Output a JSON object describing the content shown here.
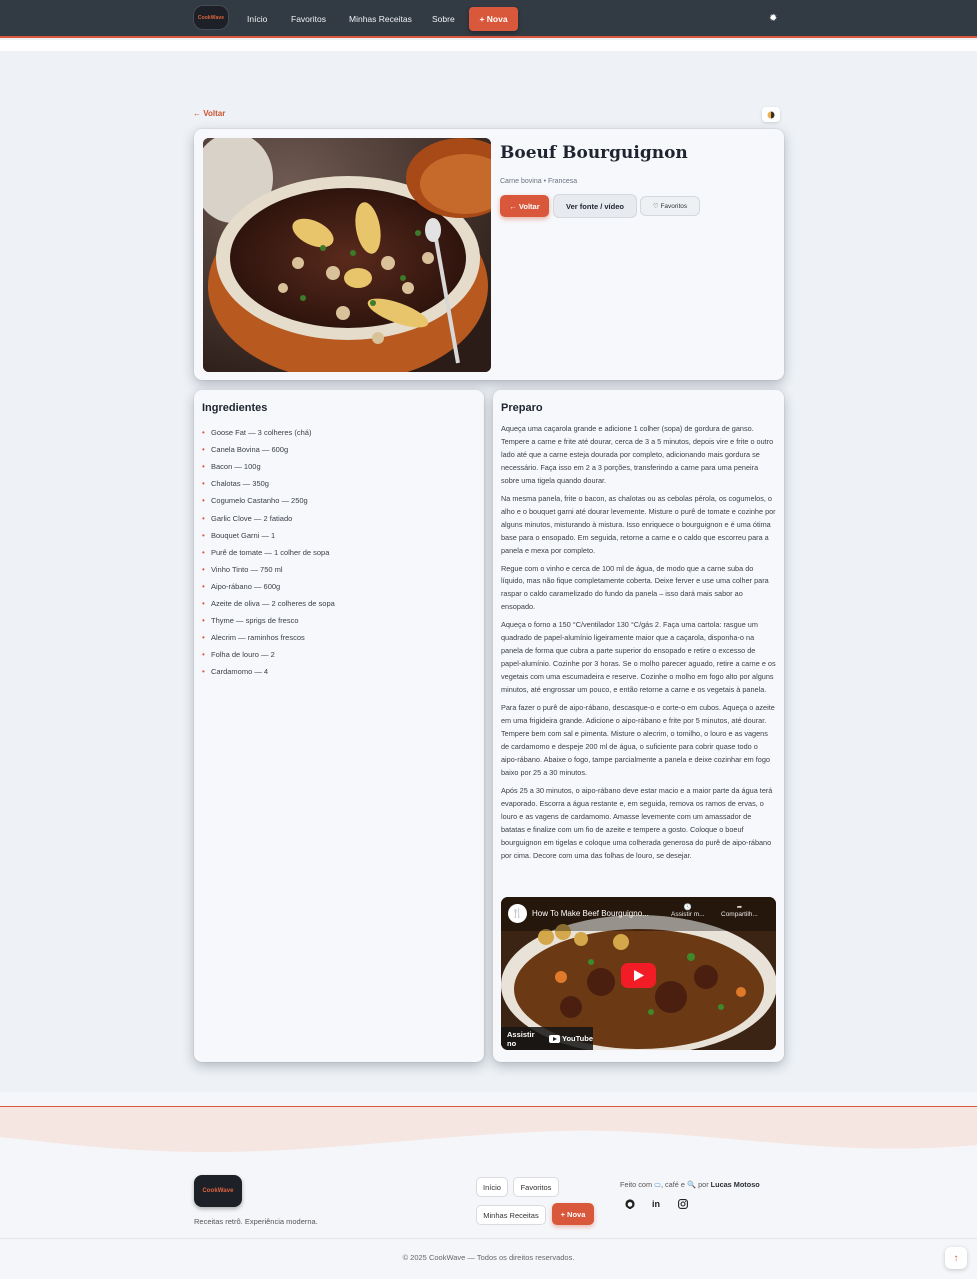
{
  "brand": {
    "name": "CookWave",
    "accent": "#d9573a",
    "dark": "#323a44"
  },
  "nav": {
    "items": [
      "Início",
      "Favoritos",
      "Minhas Receitas",
      "Sobre"
    ],
    "new_label": "+ Nova",
    "theme_icon": "sun-icon"
  },
  "page": {
    "back_link": "← Voltar",
    "title": "Boeuf Bourguignon",
    "meta": "Carne bovina • Francesa",
    "buttons": {
      "back": "← Voltar",
      "source": "Ver fonte / vídeo",
      "favorite": "♡ Favoritos"
    }
  },
  "ingredients": {
    "title": "Ingredientes",
    "items": [
      "Goose Fat — 3 colheres (chá)",
      "Canela Bovina — 600g",
      "Bacon — 100g",
      "Chalotas — 350g",
      "Cogumelo Castanho — 250g",
      "Garlic Clove — 2 fatiado",
      "Bouquet Garni — 1",
      "Purê de tomate — 1 colher de sopa",
      "Vinho Tinto — 750 ml",
      "Aipo-rábano — 600g",
      "Azeite de oliva — 2 colheres de sopa",
      "Thyme — sprigs de fresco",
      "Alecrim — raminhos frescos",
      "Folha de louro — 2",
      "Cardamomo — 4"
    ]
  },
  "preparation": {
    "title": "Preparo",
    "paragraphs": [
      "Aqueça uma caçarola grande e adicione 1 colher (sopa) de gordura de ganso. Tempere a carne e frite até dourar, cerca de 3 a 5 minutos, depois vire e frite o outro lado até que a carne esteja dourada por completo, adicionando mais gordura se necessário. Faça isso em 2 a 3 porções, transferindo a carne para uma peneira sobre uma tigela quando dourar.",
      "Na mesma panela, frite o bacon, as chalotas ou as cebolas pérola, os cogumelos, o alho e o bouquet garni até dourar levemente. Misture o purê de tomate e cozinhe por alguns minutos, misturando à mistura. Isso enriquece o bourguignon e é uma ótima base para o ensopado. Em seguida, retorne a carne e o caldo que escorreu para a panela e mexa por completo.",
      "Regue com o vinho e cerca de 100 ml de água, de modo que a carne suba do líquido, mas não fique completamente coberta. Deixe ferver e use uma colher para raspar o caldo caramelizado do fundo da panela – isso dará mais sabor ao ensopado.",
      "Aqueça o forno a 150 °C/ventilador 130 °C/gás 2. Faça uma cartola: rasgue um quadrado de papel-alumínio ligeiramente maior que a caçarola, disponha-o na panela de forma que cubra a parte superior do ensopado e retire o excesso de papel-alumínio. Cozinhe por 3 horas. Se o molho parecer aguado, retire a carne e os vegetais com uma escumadeira e reserve. Cozinhe o molho em fogo alto por alguns minutos, até engrossar um pouco, e então retorne a carne e os vegetais à panela.",
      "Para fazer o purê de aipo-rábano, descasque-o e corte-o em cubos. Aqueça o azeite em uma frigideira grande. Adicione o aipo-rábano e frite por 5 minutos, até dourar. Tempere bem com sal e pimenta. Misture o alecrim, o tomilho, o louro e as vagens de cardamomo e despeje 200 ml de água, o suficiente para cobrir quase todo o aipo-rábano. Abaixe o fogo, tampe parcialmente a panela e deixe cozinhar em fogo baixo por 25 a 30 minutos.",
      "Após 25 a 30 minutos, o aipo-rábano deve estar macio e a maior parte da água terá evaporado. Escorra a água restante e, em seguida, remova os ramos de ervas, o louro e as vagens de cardamomo. Amasse levemente com um amassador de batatas e finalize com um fio de azeite e tempere a gosto. Coloque o boeuf bourguignon em tigelas e coloque uma colherada generosa do purê de aipo-rábano por cima. Decore com uma das folhas de louro, se desejar."
    ],
    "video": {
      "title": "How To Make Beef Bourguigno...",
      "watch_later": "Assistir m...",
      "share": "Compartilh...",
      "watch_on": "Assistir no",
      "platform": "YouTube"
    }
  },
  "footer": {
    "tagline": "Receitas retrô. Experiência moderna.",
    "links": [
      "Início",
      "Favoritos",
      "Minhas Receitas"
    ],
    "new_label": "+ Nova",
    "made_with_prefix": "Feito com",
    "made_with_middle": ", café e",
    "made_with_by": "por",
    "author": "Lucas Motoso",
    "social_icons": [
      "github-icon",
      "linkedin-icon",
      "instagram-icon"
    ],
    "copyright": "© 2025 CookWave — Todos os direitos reservados.",
    "to_top": "↑"
  }
}
